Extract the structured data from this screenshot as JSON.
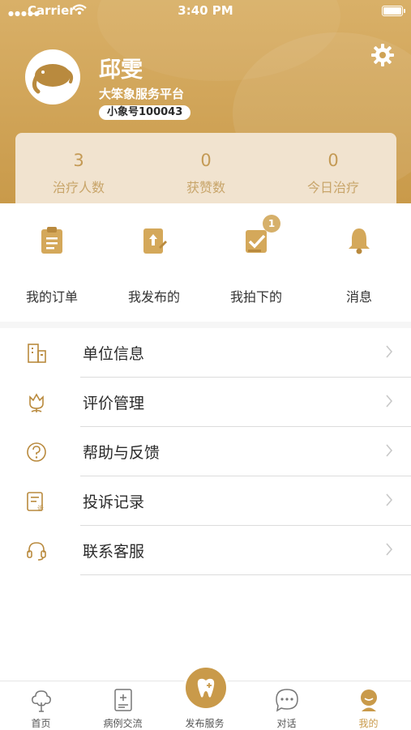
{
  "status_bar": {
    "carrier": "Carrier",
    "time": "3:40 PM"
  },
  "profile": {
    "name": "邱雯",
    "platform": "大笨象服务平台",
    "id_label": "小象号100043"
  },
  "stats": [
    {
      "value": "3",
      "label": "治疗人数"
    },
    {
      "value": "0",
      "label": "获赞数"
    },
    {
      "value": "0",
      "label": "今日治疗"
    }
  ],
  "quick_actions": [
    {
      "label": "我的订单",
      "icon": "clipboard-icon"
    },
    {
      "label": "我发布的",
      "icon": "upload-doc-icon"
    },
    {
      "label": "我拍下的",
      "icon": "check-box-icon",
      "badge": "1"
    },
    {
      "label": "消息",
      "icon": "bell-icon"
    }
  ],
  "menu": [
    {
      "label": "单位信息",
      "icon": "building-icon"
    },
    {
      "label": "评价管理",
      "icon": "flower-icon"
    },
    {
      "label": "帮助与反馈",
      "icon": "help-icon"
    },
    {
      "label": "投诉记录",
      "icon": "complaint-icon"
    },
    {
      "label": "联系客服",
      "icon": "headset-icon"
    }
  ],
  "tabbar": {
    "items": [
      {
        "label": "首页",
        "icon": "tree-icon"
      },
      {
        "label": "病例交流",
        "icon": "case-icon"
      },
      {
        "label": "发布服务",
        "icon": "tooth-icon"
      },
      {
        "label": "对话",
        "icon": "chat-icon"
      },
      {
        "label": "我的",
        "icon": "profile-icon",
        "active": true
      }
    ]
  },
  "colors": {
    "accent": "#c99a4a",
    "header_start": "#d9b068",
    "stats_card": "#f1e3cf"
  }
}
